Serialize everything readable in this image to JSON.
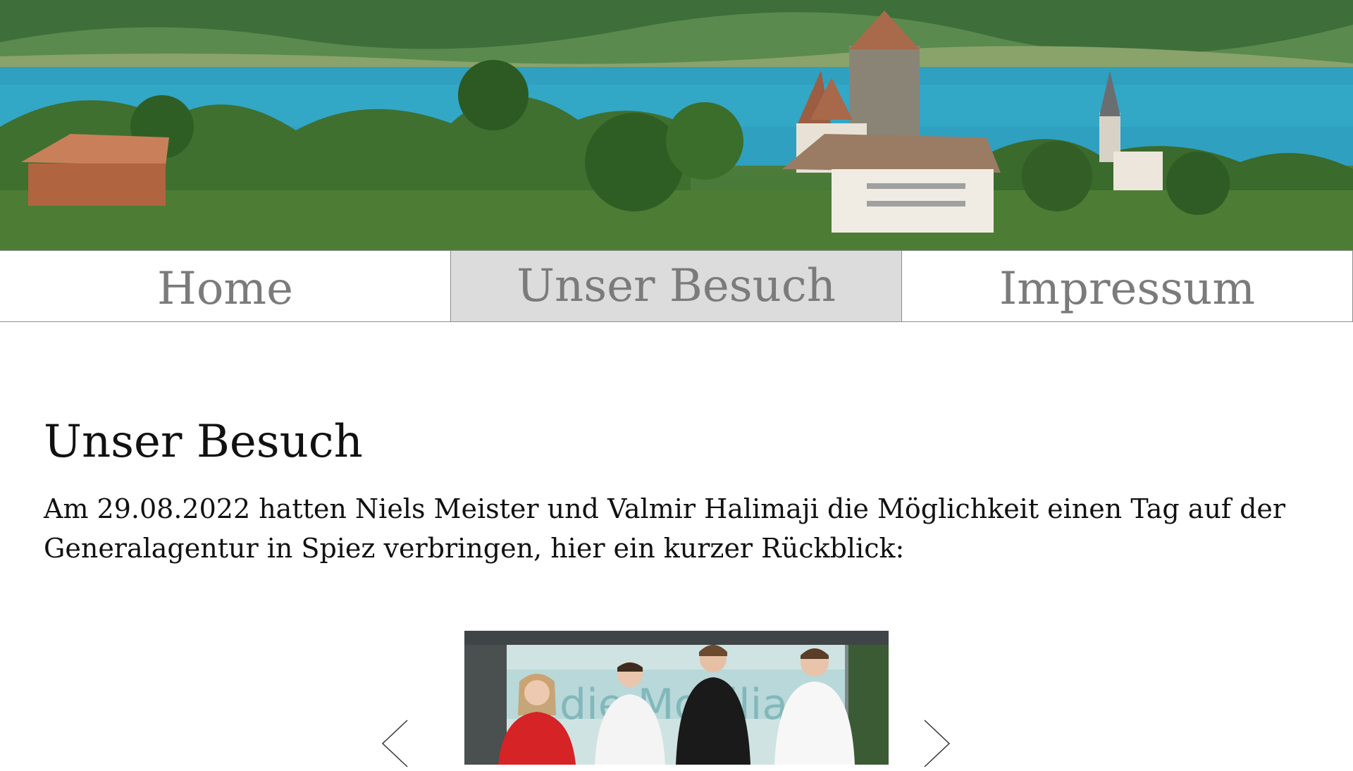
{
  "hero": {
    "image": "lake-thun-spiez-castle-banner"
  },
  "nav": {
    "items": [
      {
        "label": "Home"
      },
      {
        "label": "Unser Besuch"
      },
      {
        "label": "Impressum"
      }
    ],
    "active": "Unser Besuch"
  },
  "main": {
    "title": "Unser Besuch",
    "intro": "Am 29.08.2022 hatten Niels Meister und Valmir Halimaji die Möglichkeit einen Tag auf der Generalagentur in Spiez verbringen, hier ein kurzer Rückblick:"
  },
  "slideshow": {
    "prev_icon": "chevron-left-icon",
    "next_icon": "chevron-right-icon",
    "photo": "group-photo-four-people"
  },
  "colors": {
    "nav_text": "#7b7b7b",
    "nav_active_bg": "#dcdcdc",
    "nav_border": "#8c8c8c",
    "text": "#111111",
    "background": "#ffffff"
  }
}
